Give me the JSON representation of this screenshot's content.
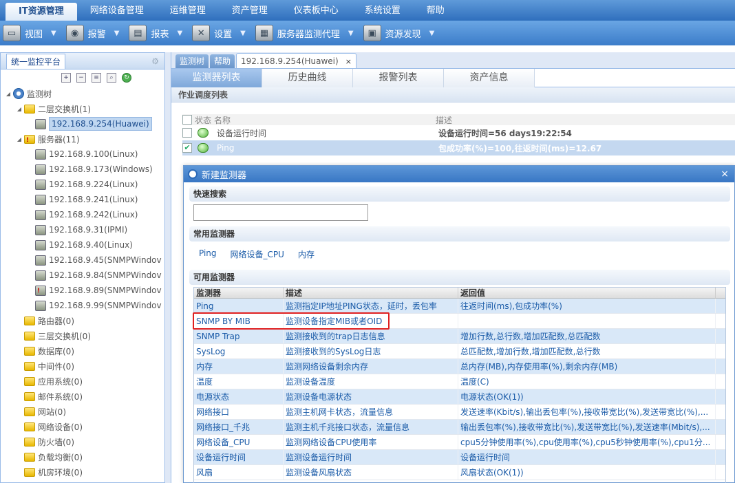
{
  "topmenu": [
    "IT资源管理",
    "网络设备管理",
    "运维管理",
    "资产管理",
    "仪表板中心",
    "系统设置",
    "帮助"
  ],
  "toolbar": [
    {
      "label": "视图",
      "icon": "view-icon"
    },
    {
      "label": "报警",
      "icon": "alarm-icon"
    },
    {
      "label": "报表",
      "icon": "report-icon"
    },
    {
      "label": "设置",
      "icon": "settings-icon"
    },
    {
      "label": "服务器监测代理",
      "icon": "server-agent-icon"
    },
    {
      "label": "资源发现",
      "icon": "discovery-icon"
    }
  ],
  "left": {
    "tab": "统一监控平台",
    "tree": [
      {
        "label": "监测树",
        "kind": "root",
        "level": 0
      },
      {
        "label": "二层交换机(1)",
        "kind": "folder",
        "level": 1
      },
      {
        "label": "192.168.9.254(Huawei)",
        "kind": "device",
        "level": 2,
        "selected": true
      },
      {
        "label": "服务器(11)",
        "kind": "folder-warn",
        "level": 1
      },
      {
        "label": "192.168.9.100(Linux)",
        "kind": "device",
        "level": 2
      },
      {
        "label": "192.168.9.173(Windows)",
        "kind": "device",
        "level": 2
      },
      {
        "label": "192.168.9.224(Linux)",
        "kind": "device",
        "level": 2
      },
      {
        "label": "192.168.9.241(Linux)",
        "kind": "device",
        "level": 2
      },
      {
        "label": "192.168.9.242(Linux)",
        "kind": "device",
        "level": 2
      },
      {
        "label": "192.168.9.31(IPMI)",
        "kind": "device",
        "level": 2
      },
      {
        "label": "192.168.9.40(Linux)",
        "kind": "device",
        "level": 2
      },
      {
        "label": "192.168.9.45(SNMPWindov",
        "kind": "device",
        "level": 2
      },
      {
        "label": "192.168.9.84(SNMPWindov",
        "kind": "device",
        "level": 2
      },
      {
        "label": "192.168.9.89(SNMPWindov",
        "kind": "device-warn",
        "level": 2
      },
      {
        "label": "192.168.9.99(SNMPWindov",
        "kind": "device",
        "level": 2
      },
      {
        "label": "路由器(0)",
        "kind": "folder",
        "level": 1
      },
      {
        "label": "三层交换机(0)",
        "kind": "folder",
        "level": 1
      },
      {
        "label": "数据库(0)",
        "kind": "folder",
        "level": 1
      },
      {
        "label": "中间件(0)",
        "kind": "folder",
        "level": 1
      },
      {
        "label": "应用系统(0)",
        "kind": "folder",
        "level": 1
      },
      {
        "label": "邮件系统(0)",
        "kind": "folder",
        "level": 1
      },
      {
        "label": "网站(0)",
        "kind": "folder",
        "level": 1
      },
      {
        "label": "网络设备(0)",
        "kind": "folder",
        "level": 1
      },
      {
        "label": "防火墙(0)",
        "kind": "folder",
        "level": 1
      },
      {
        "label": "负载均衡(0)",
        "kind": "folder",
        "level": 1
      },
      {
        "label": "机房环境(0)",
        "kind": "folder",
        "level": 1
      }
    ]
  },
  "tabs": [
    {
      "label": "监测树"
    },
    {
      "label": "帮助"
    },
    {
      "label": "192.168.9.254(Huawei)",
      "active": true,
      "close": "×"
    }
  ],
  "subtabs": [
    "监测器列表",
    "历史曲线",
    "报警列表",
    "资产信息"
  ],
  "job_header": "作业调度列表",
  "monitors": {
    "headers": [
      "状态",
      "名称",
      "描述"
    ],
    "rows": [
      {
        "name": "设备运行时间",
        "desc": "设备运行时间=56 days19:22:54",
        "checked": false
      },
      {
        "name": "Ping",
        "desc": "包成功率(%)=100,往返时间(ms)=12.67",
        "checked": true
      }
    ]
  },
  "dialog": {
    "title": "新建监测器",
    "close": "×",
    "quick_search": "快速搜索",
    "common_title": "常用监测器",
    "common": [
      "Ping",
      "网络设备_CPU",
      "内存"
    ],
    "available_title": "可用监测器",
    "columns": [
      "监测器",
      "描述",
      "返回值"
    ],
    "rows": [
      {
        "name": "Ping",
        "desc": "监测指定IP地址PING状态，延时，丢包率",
        "ret": "往返时间(ms),包成功率(%)"
      },
      {
        "name": "SNMP BY MIB",
        "desc": "监测设备指定MIB或者OID",
        "ret": ""
      },
      {
        "name": "SNMP Trap",
        "desc": "监测接收到的trap日志信息",
        "ret": "增加行数,总行数,增加匹配数,总匹配数"
      },
      {
        "name": "SysLog",
        "desc": "监测接收到的SysLog日志",
        "ret": "总匹配数,增加行数,增加匹配数,总行数"
      },
      {
        "name": "内存",
        "desc": "监测网络设备剩余内存",
        "ret": "总内存(MB),内存使用率(%),剩余内存(MB)"
      },
      {
        "name": "温度",
        "desc": "监测设备温度",
        "ret": "温度(C)"
      },
      {
        "name": "电源状态",
        "desc": "监测设备电源状态",
        "ret": "电源状态(OK(1))"
      },
      {
        "name": "网络接口",
        "desc": "监测主机网卡状态，流量信息",
        "ret": "发送速率(Kbit/s),输出丢包率(%),接收带宽比(%),发送带宽比(%),..."
      },
      {
        "name": "网络接口_千兆",
        "desc": "监测主机千兆接口状态，流量信息",
        "ret": "输出丢包率(%),接收带宽比(%),发送带宽比(%),发送速率(Mbit/s),..."
      },
      {
        "name": "网络设备_CPU",
        "desc": "监测网络设备CPU使用率",
        "ret": "cpu5分钟使用率(%),cpu使用率(%),cpu5秒钟使用率(%),cpu1分..."
      },
      {
        "name": "设备运行时间",
        "desc": "监测设备运行时间",
        "ret": "设备运行时间"
      },
      {
        "name": "风扇",
        "desc": "监测设备风扇状态",
        "ret": "风扇状态(OK(1))"
      }
    ]
  }
}
